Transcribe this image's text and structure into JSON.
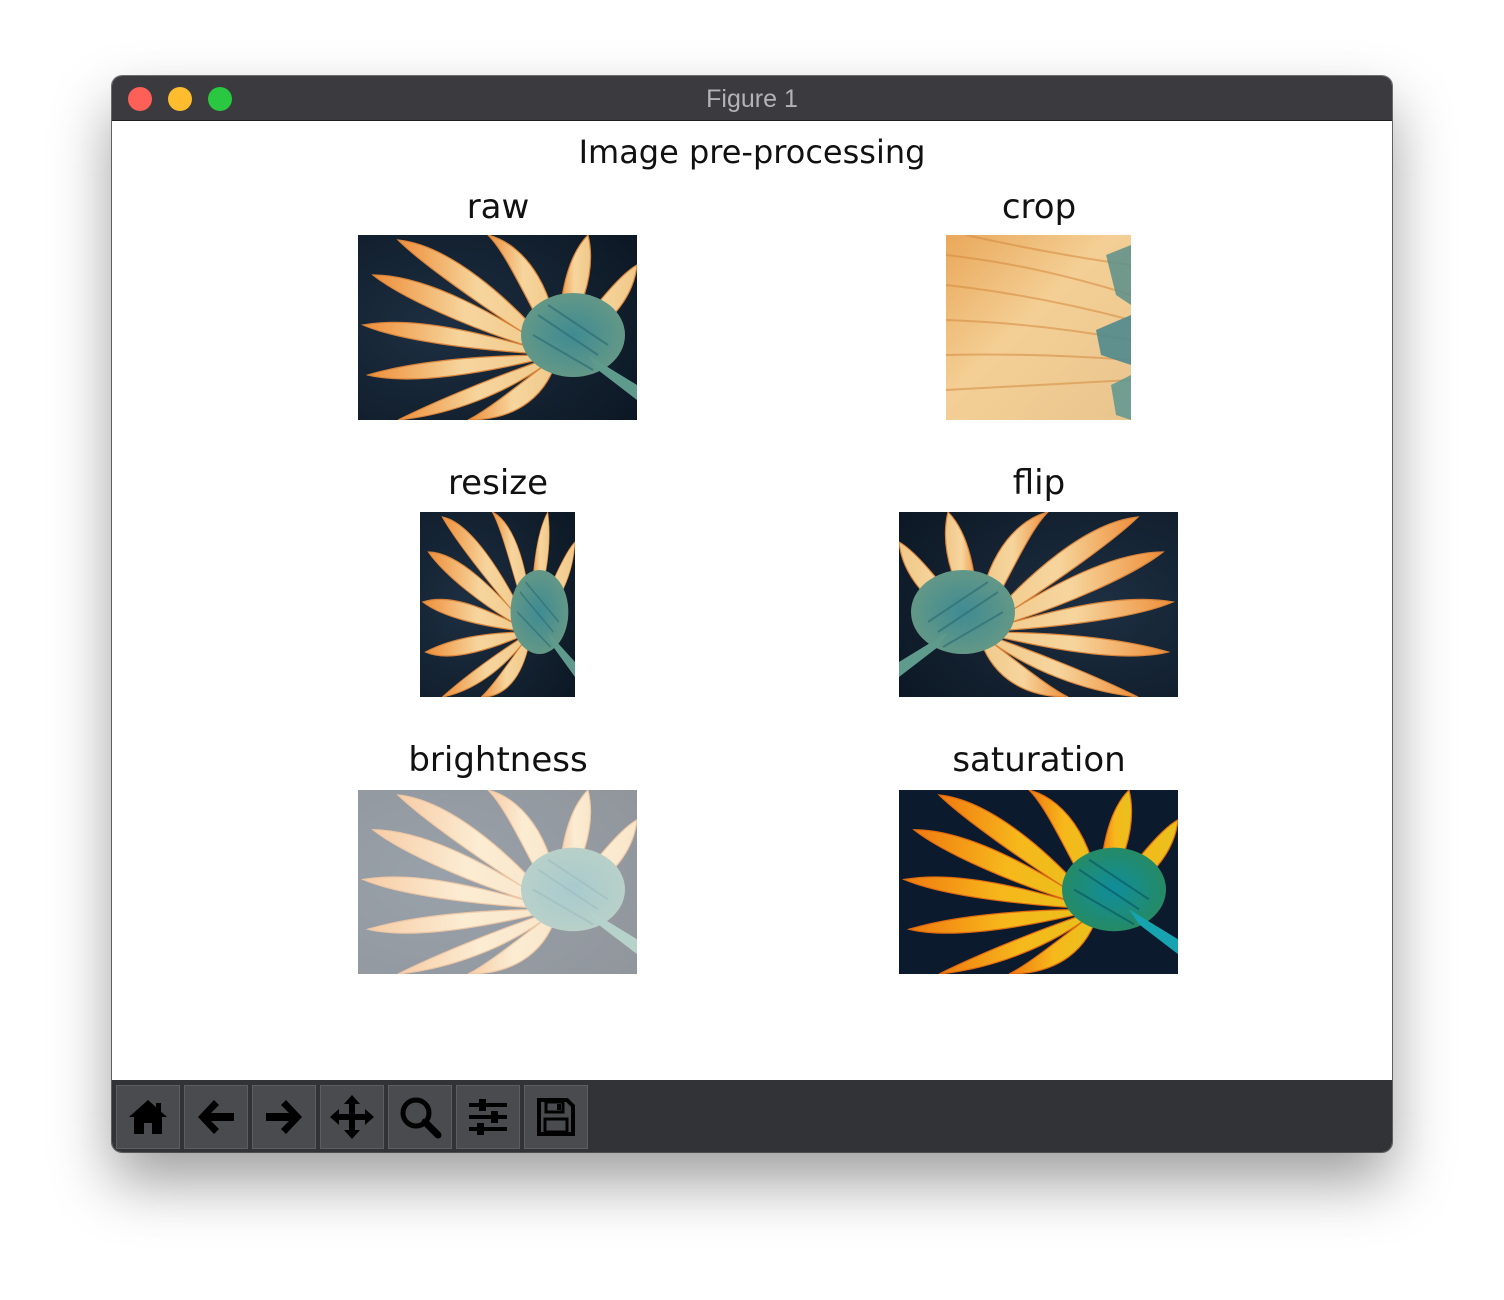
{
  "window": {
    "title": "Figure 1"
  },
  "figure": {
    "suptitle": "Image pre-processing",
    "panels": [
      {
        "id": "raw",
        "title": "raw"
      },
      {
        "id": "crop",
        "title": "crop"
      },
      {
        "id": "resize",
        "title": "resize"
      },
      {
        "id": "flip",
        "title": "flip"
      },
      {
        "id": "brightness",
        "title": "brightness"
      },
      {
        "id": "saturation",
        "title": "saturation"
      }
    ]
  },
  "toolbar": {
    "buttons": [
      {
        "icon": "home-icon"
      },
      {
        "icon": "back-arrow-icon"
      },
      {
        "icon": "forward-arrow-icon"
      },
      {
        "icon": "pan-move-icon"
      },
      {
        "icon": "zoom-magnifier-icon"
      },
      {
        "icon": "configure-subplots-icon"
      },
      {
        "icon": "save-disk-icon"
      }
    ]
  },
  "colors": {
    "titlebar": "#3a3a3f",
    "toolbar": "#323336",
    "petal_orange": "#f2a24c",
    "petal_cream": "#f6d9a4",
    "flower_center": "#4a8a8c",
    "background_dark": "#0f1d2c"
  }
}
